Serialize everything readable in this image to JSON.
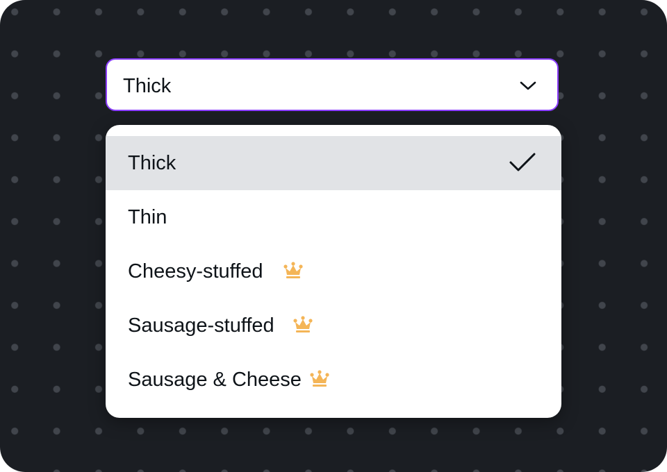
{
  "select": {
    "value": "Thick",
    "icon": "chevron-down-icon",
    "focus_color": "#8b3dff"
  },
  "menu": {
    "options": [
      {
        "label": "Thick",
        "selected": true,
        "premium": false
      },
      {
        "label": "Thin",
        "selected": false,
        "premium": false
      },
      {
        "label": "Cheesy-stuffed",
        "selected": false,
        "premium": true
      },
      {
        "label": "Sausage-stuffed",
        "selected": false,
        "premium": true
      },
      {
        "label": "Sausage & Cheese",
        "selected": false,
        "premium": true
      }
    ],
    "selected_icon": "checkmark-icon",
    "premium_icon": "crown-icon",
    "premium_color": "#f4b557",
    "selected_background": "#e1e3e6"
  },
  "colors": {
    "background": "#1b1e23",
    "dots": "#41454c",
    "text": "#0e1318"
  }
}
